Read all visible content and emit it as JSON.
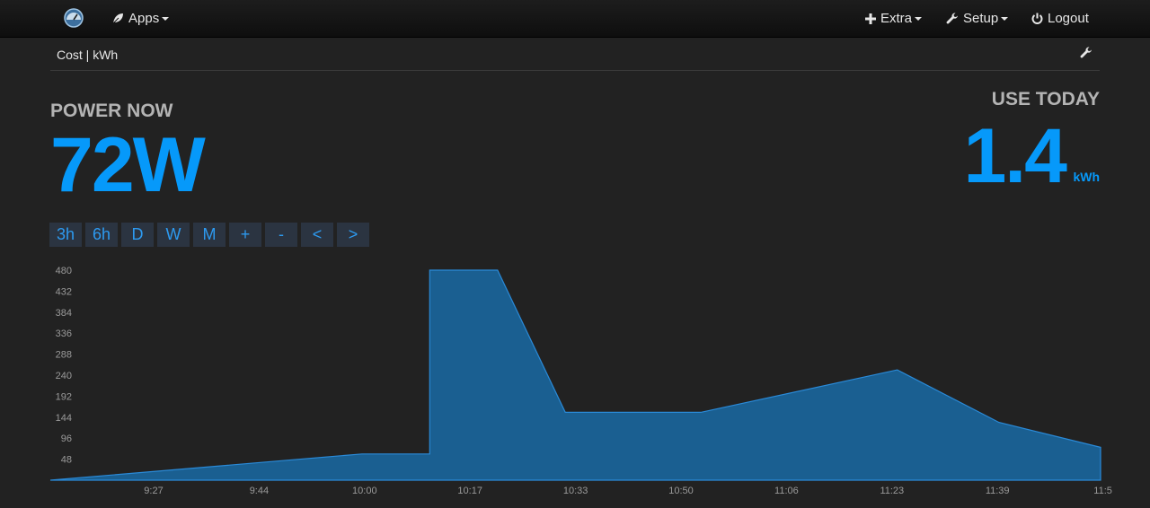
{
  "navbar": {
    "logo_icon": "dashboard-logo-icon",
    "apps_label": "Apps",
    "extra_label": "Extra",
    "setup_label": "Setup",
    "logout_label": "Logout"
  },
  "subbar": {
    "title": "Cost | kWh"
  },
  "power_now": {
    "label": "POWER NOW",
    "value": "72W"
  },
  "use_today": {
    "label": "USE TODAY",
    "value": "1.4",
    "unit": "kWh"
  },
  "range_buttons": [
    "3h",
    "6h",
    "D",
    "W",
    "M",
    "+",
    "-",
    "<",
    ">"
  ],
  "colors": {
    "accent": "#0699fa",
    "area_fill": "#1a5f91",
    "area_stroke": "#2a8ad8",
    "background": "#222222"
  },
  "chart_data": {
    "type": "area",
    "y_ticks": [
      "480",
      "432",
      "384",
      "336",
      "288",
      "240",
      "192",
      "144",
      "96",
      "48"
    ],
    "x_ticks": [
      "9:27",
      "9:44",
      "10:00",
      "10:17",
      "10:33",
      "10:50",
      "11:06",
      "11:23",
      "11:39",
      "11:5"
    ],
    "ylim": [
      0,
      480
    ],
    "points": [
      {
        "t": "9:19",
        "y": 0
      },
      {
        "t": "10:05",
        "y": 60
      },
      {
        "t": "10:15",
        "y": 60
      },
      {
        "t": "10:15",
        "y": 480
      },
      {
        "t": "10:25",
        "y": 480
      },
      {
        "t": "10:35",
        "y": 155
      },
      {
        "t": "10:55",
        "y": 155
      },
      {
        "t": "11:24",
        "y": 252
      },
      {
        "t": "11:39",
        "y": 132
      },
      {
        "t": "11:54",
        "y": 75
      }
    ]
  }
}
